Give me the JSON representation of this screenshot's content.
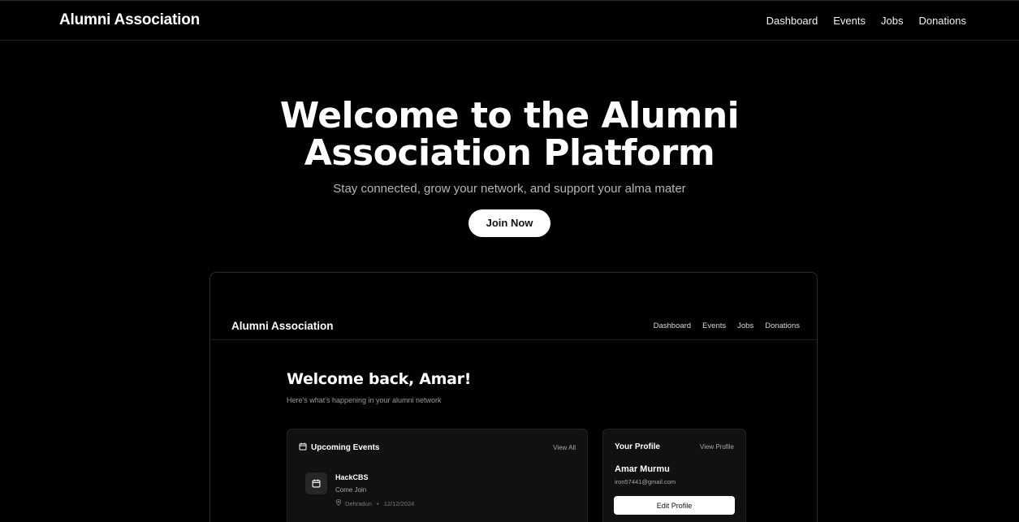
{
  "nav": {
    "brand": "Alumni Association",
    "links": [
      "Dashboard",
      "Events",
      "Jobs",
      "Donations"
    ]
  },
  "hero": {
    "title_line1": "Welcome to the Alumni",
    "title_line2": "Association Platform",
    "subtitle": "Stay connected, grow your network, and support your alma mater",
    "cta": "Join Now"
  },
  "preview": {
    "nav": {
      "brand": "Alumni Association",
      "links": [
        "Dashboard",
        "Events",
        "Jobs",
        "Donations"
      ]
    },
    "welcome": {
      "title": "Welcome back, Amar!",
      "subtitle": "Here's what's happening in your alumni network"
    },
    "events": {
      "title": "Upcoming Events",
      "view_all": "View All",
      "items": [
        {
          "name": "HackCBS",
          "description": "Come Join",
          "location": "Dehradun",
          "date": "12/12/2024"
        }
      ]
    },
    "profile": {
      "title": "Your Profile",
      "view_link": "View Profile",
      "name": "Amar Murmu",
      "email": "iron57441@gmail.com",
      "edit_button": "Edit Profile"
    }
  },
  "icons": {
    "calendar": "calendar-icon",
    "location": "map-pin-icon"
  }
}
